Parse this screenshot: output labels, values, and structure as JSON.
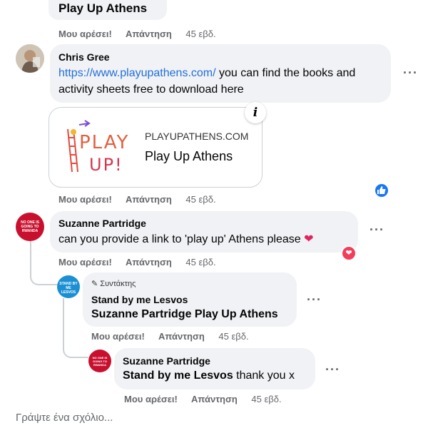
{
  "top_card": {
    "title": "Play Up Athens"
  },
  "top_actions": {
    "like": "Μου αρέσει!",
    "reply": "Απάντηση",
    "time": "45 εβδ."
  },
  "comment1": {
    "author": "Chris Gree",
    "link": "https://www.playupathens.com/",
    "text": " you can find the books and activity sheets free to download here",
    "actions": {
      "like": "Μου αρέσει!",
      "reply": "Απάντηση",
      "time": "45 εβδ."
    },
    "preview": {
      "domain": "PLAYUPATHENS.COM",
      "title": "Play Up Athens",
      "info_icon": "i",
      "logo_line1": "PLAY",
      "logo_line2": "UP!"
    }
  },
  "comment2": {
    "author": "Suzanne Partridge",
    "avatar_text": "NO ONE IS GOING TO RWANDA",
    "text": "can you provide a link to 'play up' Athens please",
    "actions": {
      "like": "Μου αρέσει!",
      "reply": "Απάντηση",
      "time": "45 εβδ."
    }
  },
  "reply1": {
    "badge": "Συντάκτης",
    "author": "Stand by me Lesvos",
    "avatar_text": "STAND BY ME LESVOS",
    "mention": "Suzanne Partridge",
    "text": " Play Up Athens",
    "actions": {
      "like": "Μου αρέσει!",
      "reply": "Απάντηση",
      "time": "45 εβδ."
    }
  },
  "reply2": {
    "author": "Suzanne Partridge",
    "avatar_text": "NO ONE IS GOING TO RWANDA",
    "mention": "Stand by me Lesvos",
    "text": " thank you x",
    "actions": {
      "like": "Μου αρέσει!",
      "reply": "Απάντηση",
      "time": "45 εβδ."
    }
  },
  "write_comment": {
    "placeholder": "Γράψτε ένα σχόλιο..."
  },
  "colors": {
    "link": "#216fdb",
    "bubble": "#f0f2f5",
    "like_blue": "#1877f2",
    "love_red": "#f33e58",
    "meta": "#65676b"
  }
}
